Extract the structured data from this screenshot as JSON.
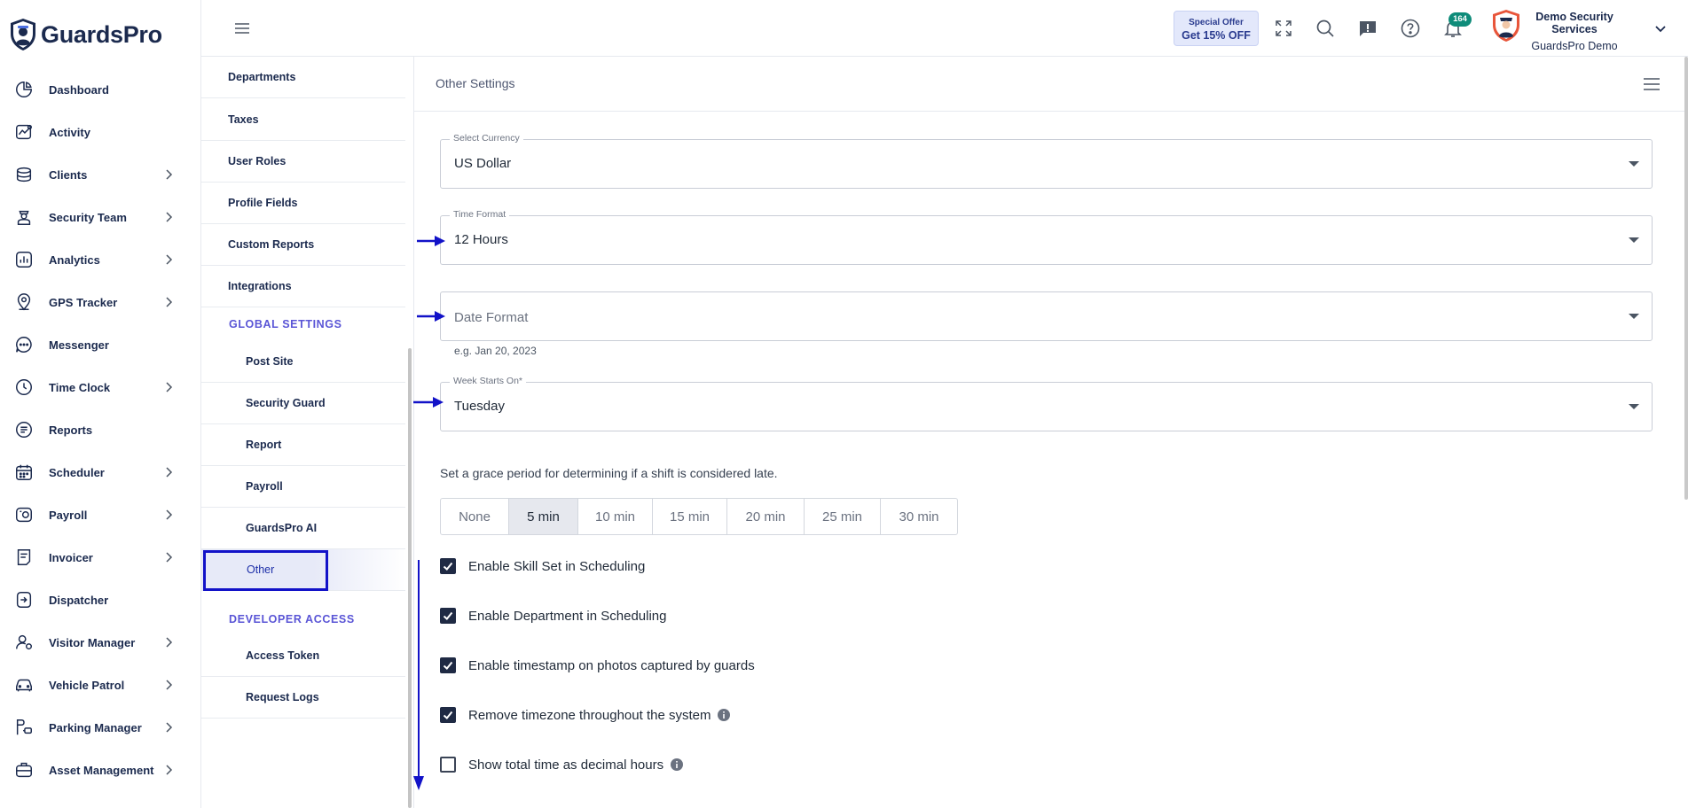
{
  "brand": {
    "name": "GuardsPro"
  },
  "sidebar": {
    "items": [
      {
        "label": "Dashboard",
        "icon": "dashboard-icon",
        "has_children": false
      },
      {
        "label": "Activity",
        "icon": "activity-icon",
        "has_children": false
      },
      {
        "label": "Clients",
        "icon": "clients-icon",
        "has_children": true
      },
      {
        "label": "Security Team",
        "icon": "security-team-icon",
        "has_children": true
      },
      {
        "label": "Analytics",
        "icon": "analytics-icon",
        "has_children": true
      },
      {
        "label": "GPS Tracker",
        "icon": "location-pin-icon",
        "has_children": true
      },
      {
        "label": "Messenger",
        "icon": "chat-icon",
        "has_children": false
      },
      {
        "label": "Time Clock",
        "icon": "clock-icon",
        "has_children": true
      },
      {
        "label": "Reports",
        "icon": "reports-icon",
        "has_children": false
      },
      {
        "label": "Scheduler",
        "icon": "calendar-icon",
        "has_children": true
      },
      {
        "label": "Payroll",
        "icon": "payroll-icon",
        "has_children": true
      },
      {
        "label": "Invoicer",
        "icon": "invoice-icon",
        "has_children": true
      },
      {
        "label": "Dispatcher",
        "icon": "dispatcher-icon",
        "has_children": false
      },
      {
        "label": "Visitor Manager",
        "icon": "visitor-icon",
        "has_children": true
      },
      {
        "label": "Vehicle Patrol",
        "icon": "car-icon",
        "has_children": true
      },
      {
        "label": "Parking Manager",
        "icon": "parking-icon",
        "has_children": true
      },
      {
        "label": "Asset Management",
        "icon": "briefcase-icon",
        "has_children": true
      }
    ]
  },
  "header": {
    "offer_top": "Special Offer",
    "offer_bottom": "Get 15% OFF",
    "notification_count": "164",
    "user_name": "Demo Security Services",
    "user_org": "GuardsPro Demo"
  },
  "submenu": {
    "top_items": [
      "Departments",
      "Taxes",
      "User Roles",
      "Profile Fields",
      "Custom Reports",
      "Integrations"
    ],
    "global_heading": "GLOBAL SETTINGS",
    "global_items": [
      "Post Site",
      "Security Guard",
      "Report",
      "Payroll",
      "GuardsPro AI",
      "Other"
    ],
    "active_item": "Other",
    "developer_heading": "DEVELOPER ACCESS",
    "developer_items": [
      "Access Token",
      "Request Logs"
    ]
  },
  "panel": {
    "title": "Other Settings",
    "currency": {
      "label": "Select Currency",
      "value": "US Dollar"
    },
    "time_format": {
      "label": "Time Format",
      "value": "12 Hours"
    },
    "date_format": {
      "placeholder": "Date Format",
      "helper": "e.g. Jan 20, 2023"
    },
    "week_start": {
      "label": "Week Starts On*",
      "value": "Tuesday"
    },
    "grace_text": "Set a grace period for determining if a shift is considered late.",
    "grace_options": [
      "None",
      "5 min",
      "10 min",
      "15 min",
      "20 min",
      "25 min",
      "30 min"
    ],
    "grace_selected": "5 min",
    "checkboxes": [
      {
        "label": "Enable Skill Set in Scheduling",
        "checked": true,
        "info": false
      },
      {
        "label": "Enable Department in Scheduling",
        "checked": true,
        "info": false
      },
      {
        "label": "Enable timestamp on photos captured by guards",
        "checked": true,
        "info": false
      },
      {
        "label": "Remove timezone throughout the system",
        "checked": true,
        "info": true
      },
      {
        "label": "Show total time as decimal hours",
        "checked": false,
        "info": true
      }
    ]
  },
  "colors": {
    "navy": "#1b2a4e",
    "accent": "#5a55d6",
    "annotation": "#1212c8",
    "badge": "#0f8c7a"
  }
}
